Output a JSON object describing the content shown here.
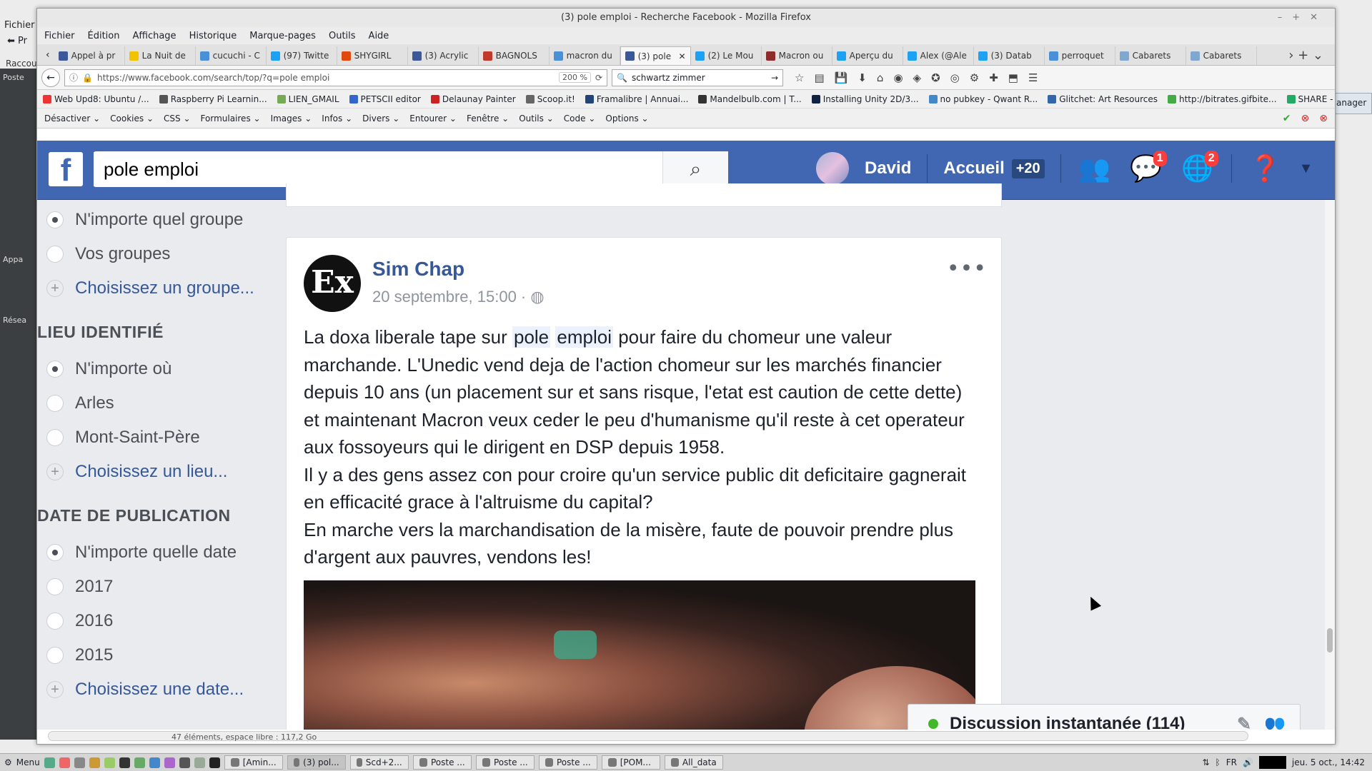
{
  "bg": {
    "menu": "Fichier",
    "side": [
      "Poste",
      "Appa",
      "Résea"
    ],
    "right": "anager",
    "short": "Raccou",
    "pr": "Pr"
  },
  "window": {
    "title": "(3) pole emploi - Recherche Facebook - Mozilla Firefox"
  },
  "menu": [
    "Fichier",
    "Édition",
    "Affichage",
    "Historique",
    "Marque-pages",
    "Outils",
    "Aide"
  ],
  "tabs": [
    {
      "label": "Appel à pr",
      "color": "#3b5998"
    },
    {
      "label": "La Nuit de",
      "color": "#f2c200"
    },
    {
      "label": "cucuchi - C",
      "color": "#4a90d9"
    },
    {
      "label": "(97) Twitte",
      "color": "#1da1f2"
    },
    {
      "label": "SHYGIRL",
      "color": "#e04a0f"
    },
    {
      "label": "(3) Acrylic",
      "color": "#3b5998"
    },
    {
      "label": "BAGNOLS",
      "color": "#c0392b"
    },
    {
      "label": "macron du",
      "color": "#4a90d9"
    },
    {
      "label": "(3) pole",
      "color": "#3b5998"
    },
    {
      "label": "(2) Le Mou",
      "color": "#1da1f2"
    },
    {
      "label": "Macron ou",
      "color": "#8e2c2c"
    },
    {
      "label": "Aperçu du",
      "color": "#1da1f2"
    },
    {
      "label": "Alex (@Ale",
      "color": "#1da1f2"
    },
    {
      "label": "(3) Datab",
      "color": "#1da1f2"
    },
    {
      "label": "perroquet",
      "color": "#4a90d9"
    },
    {
      "label": "Cabarets",
      "color": "#7fa7d0"
    },
    {
      "label": "Cabarets",
      "color": "#7fa7d0"
    }
  ],
  "nav": {
    "url": "https://www.facebook.com/search/top/?q=pole emploi",
    "zoom": "200 %",
    "search": "schwartz zimmer"
  },
  "bookmarks": [
    "Web Upd8: Ubuntu /...",
    "Raspberry Pi Learnin...",
    "LIEN_GMAIL",
    "PETSCII editor",
    "Delaunay Painter",
    "Scoop.it!",
    "Framalibre | Annuai...",
    "Mandelbulb.com | T...",
    "Installing Unity 2D/3...",
    "no pubkey - Qwant R...",
    "Glitchet: Art Resources",
    "http://bitrates.gifbite...",
    "SHARE - FAQ"
  ],
  "devtools": [
    "Désactiver",
    "Cookies",
    "CSS",
    "Formulaires",
    "Images",
    "Infos",
    "Divers",
    "Entourer",
    "Fenêtre",
    "Outils",
    "Code",
    "Options"
  ],
  "fb": {
    "search": "pole emploi",
    "user": "David",
    "home": "Accueil",
    "home_badge": "+20",
    "messages_badge": "1",
    "notif_badge": "2",
    "groups": [
      "N'importe quel groupe",
      "Vos groupes",
      "Choisissez un groupe..."
    ],
    "location_head": "LIEU IDENTIFIÉ",
    "locations": [
      "N'importe où",
      "Arles",
      "Mont-Saint-Père",
      "Choisissez un lieu..."
    ],
    "date_head": "DATE DE PUBLICATION",
    "dates": [
      "N'importe quelle date",
      "2017",
      "2016",
      "2015",
      "Choisissez une date..."
    ]
  },
  "post": {
    "author": "Sim Chap",
    "avatar_text": "Ex",
    "time": "20 septembre, 15:00 ·",
    "before": "La doxa liberale tape sur",
    "kw1": "pole",
    "kw2": "emploi",
    "after": "pour faire du chomeur une valeur marchande. L'Unedic vend deja de l'action chomeur sur les marchés financier depuis 10 ans (un placement sur et sans risque, l'etat est caution de cette dette) et maintenant Macron veux ceder le peu d'humanisme qu'il reste à cet operateur aux fossoyeurs qui le dirigent en DSP depuis 1958.",
    "line2": "Il y a des gens assez con pour croire qu'un service public dit deficitaire gagnerait en efficacité grace à l'altruisme du capital?",
    "line3": "En marche vers la marchandisation de la misère, faute de pouvoir prendre plus d'argent aux pauvres, vendons les!"
  },
  "chat": {
    "label": "Discussion instantanée (114)"
  },
  "status": "47 éléments, espace libre : 117,2 Go",
  "taskbar": {
    "menu": "Menu",
    "tasks": [
      "[Amin...",
      "(3) pol...",
      "Scd+2...",
      "Poste ...",
      "Poste ...",
      "Poste ...",
      "[POM...",
      "All_data"
    ],
    "lang": "FR",
    "clock": "jeu. 5 oct., 14:42"
  }
}
